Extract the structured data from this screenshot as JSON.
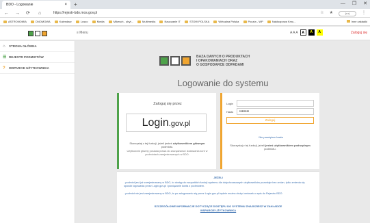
{
  "browser": {
    "tab_title": "BDO - Logowanie",
    "tab_close": "×",
    "new_tab": "+",
    "window_controls": [
      "—",
      "❐",
      "✕"
    ],
    "nav": {
      "back": "←",
      "forward": "→",
      "reload": "⟳",
      "home": "⌂"
    },
    "url": "https://rejestr-bdo.mos.gov.pl",
    "addr_icons": [
      "☆",
      "★",
      "⋮"
    ],
    "profile_label": "(•••)",
    "bookmarks": [
      "ASTRONOMIA",
      "DNOMOWA",
      "Kalendarz",
      "Luszo",
      "Media",
      "Mikesch - ubyt...",
      "Multimedia",
      "Nauczanie IT",
      "STOW POLSKA",
      "Wirtualna Polska",
      "Poczta - WP",
      "Nakłoopowa Kmu..."
    ],
    "bookmarks_right": "Inne zakładki"
  },
  "header": {
    "menu_label": "≡ Menu",
    "access_text": "A A A",
    "contrast_buttons": [
      "A",
      "A",
      "A"
    ],
    "login_link": "Zaloguj się"
  },
  "sidebar": {
    "items": [
      {
        "icon": "⌂",
        "label": "STRONA GŁÓWNA"
      },
      {
        "icon": "☰",
        "label": "REJESTR PODMIOTÓW"
      },
      {
        "icon": "?",
        "label": "WSPARCIE UŻYTKOWNIKA"
      }
    ]
  },
  "brand": {
    "line1": "BAZA DANYCH O PRODUKTACH",
    "line2": "I OPAKOWANIACH ORAZ",
    "line3": "O GOSPODARCE ODPADAMI"
  },
  "page_title": "Logowanie do systemu",
  "left_card": {
    "heading": "Zaloguj się przez",
    "logo_main": "Login",
    "logo_suffix": ".gov.pl",
    "text1_a": "Skorzystaj z tej funkcji, jeżeli jesteś ",
    "text1_b": "użytkownikiem głównym",
    "text1_c": " podmiotu.",
    "text2": "Użytkownik główny posiada prawa do zarządzania i dodawania kont w podmiotach zarejestrowanych w BDO."
  },
  "right_card": {
    "login_label": "Login",
    "login_value": "",
    "password_label": "Hasło",
    "password_value": "••••••••",
    "submit": "Zaloguj",
    "forgot": "Nie pamiętam hasła",
    "text_a": "Skorzystaj z tej funkcji, jeżeli ",
    "text_b": "jesteś użytkownikiem podrzędnym",
    "text_c": " podmiotu."
  },
  "info": {
    "heading": "JEŻELI",
    "p1": "- podmiot jest już zarejestrowany w BDO, to dostęp do wszystkich funkcji systemu dla dotychczasowych użytkowników pozostaje bez zmian, tylko zmienia się sposób logowania przez Login.gov.pl i powiązanie konta z podmiotem.",
    "p2": "- podmiot nie jest zarejestrowany w BDO, to po zalogowaniu się przez Login.gov.pl będzie można złożyć wniosek o wpis do Rejestru BDO.",
    "link1": "SZCZEGÓŁOWE INFORMACJE DOTYCZĄCE DOSTĘPU DO SYSTEMU ZNAJDZIESZ W ZAKŁADCE",
    "link2": "WSPARCIE UŻYTKOWNIKA"
  }
}
